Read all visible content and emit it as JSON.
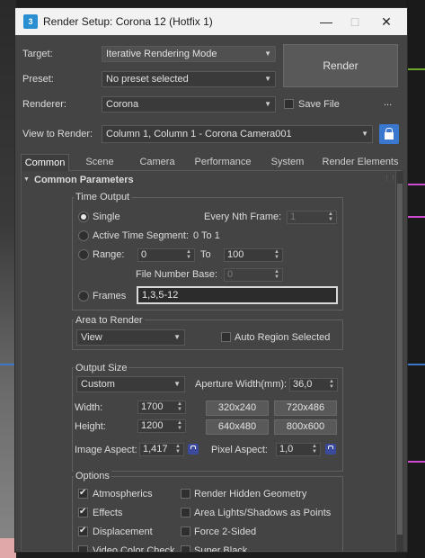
{
  "window": {
    "title": "Render Setup: Corona 12 (Hotfix 1)",
    "app_icon": "3"
  },
  "top": {
    "target_label": "Target:",
    "target_value": "Iterative Rendering Mode",
    "preset_label": "Preset:",
    "preset_value": "No preset selected",
    "renderer_label": "Renderer:",
    "renderer_value": "Corona",
    "render_button": "Render",
    "save_file_label": "Save File",
    "ellipsis": "...",
    "view_label": "View to Render:",
    "view_value": "Column 1, Column 1 - Corona Camera001"
  },
  "tabs": [
    "Common",
    "Scene",
    "Camera",
    "Performance",
    "System",
    "Render Elements"
  ],
  "rollout": {
    "title": "Common Parameters"
  },
  "time_output": {
    "title": "Time Output",
    "single": "Single",
    "every_nth_label": "Every Nth Frame:",
    "every_nth_value": "1",
    "active_segment": "Active Time Segment:",
    "active_segment_value": "0 To 1",
    "range": "Range:",
    "range_from": "0",
    "to": "To",
    "range_to": "100",
    "file_number_base_label": "File Number Base:",
    "file_number_base_value": "0",
    "frames": "Frames",
    "frames_value": "1,3,5-12"
  },
  "area_to_render": {
    "title": "Area to Render",
    "value": "View",
    "auto_region": "Auto Region Selected"
  },
  "output_size": {
    "title": "Output Size",
    "preset": "Custom",
    "aperture_label": "Aperture Width(mm):",
    "aperture_value": "36,0",
    "width_label": "Width:",
    "width_value": "1700",
    "height_label": "Height:",
    "height_value": "1200",
    "presets": [
      "320x240",
      "720x486",
      "640x480",
      "800x600"
    ],
    "image_aspect_label": "Image Aspect:",
    "image_aspect_value": "1,417",
    "pixel_aspect_label": "Pixel Aspect:",
    "pixel_aspect_value": "1,0"
  },
  "options": {
    "title": "Options",
    "atmospherics": "Atmospherics",
    "render_hidden_geometry": "Render Hidden Geometry",
    "effects": "Effects",
    "area_lights": "Area Lights/Shadows as Points",
    "displacement": "Displacement",
    "force_2sided": "Force 2-Sided",
    "video_color_check": "Video Color Check",
    "super_black": "Super Black"
  }
}
